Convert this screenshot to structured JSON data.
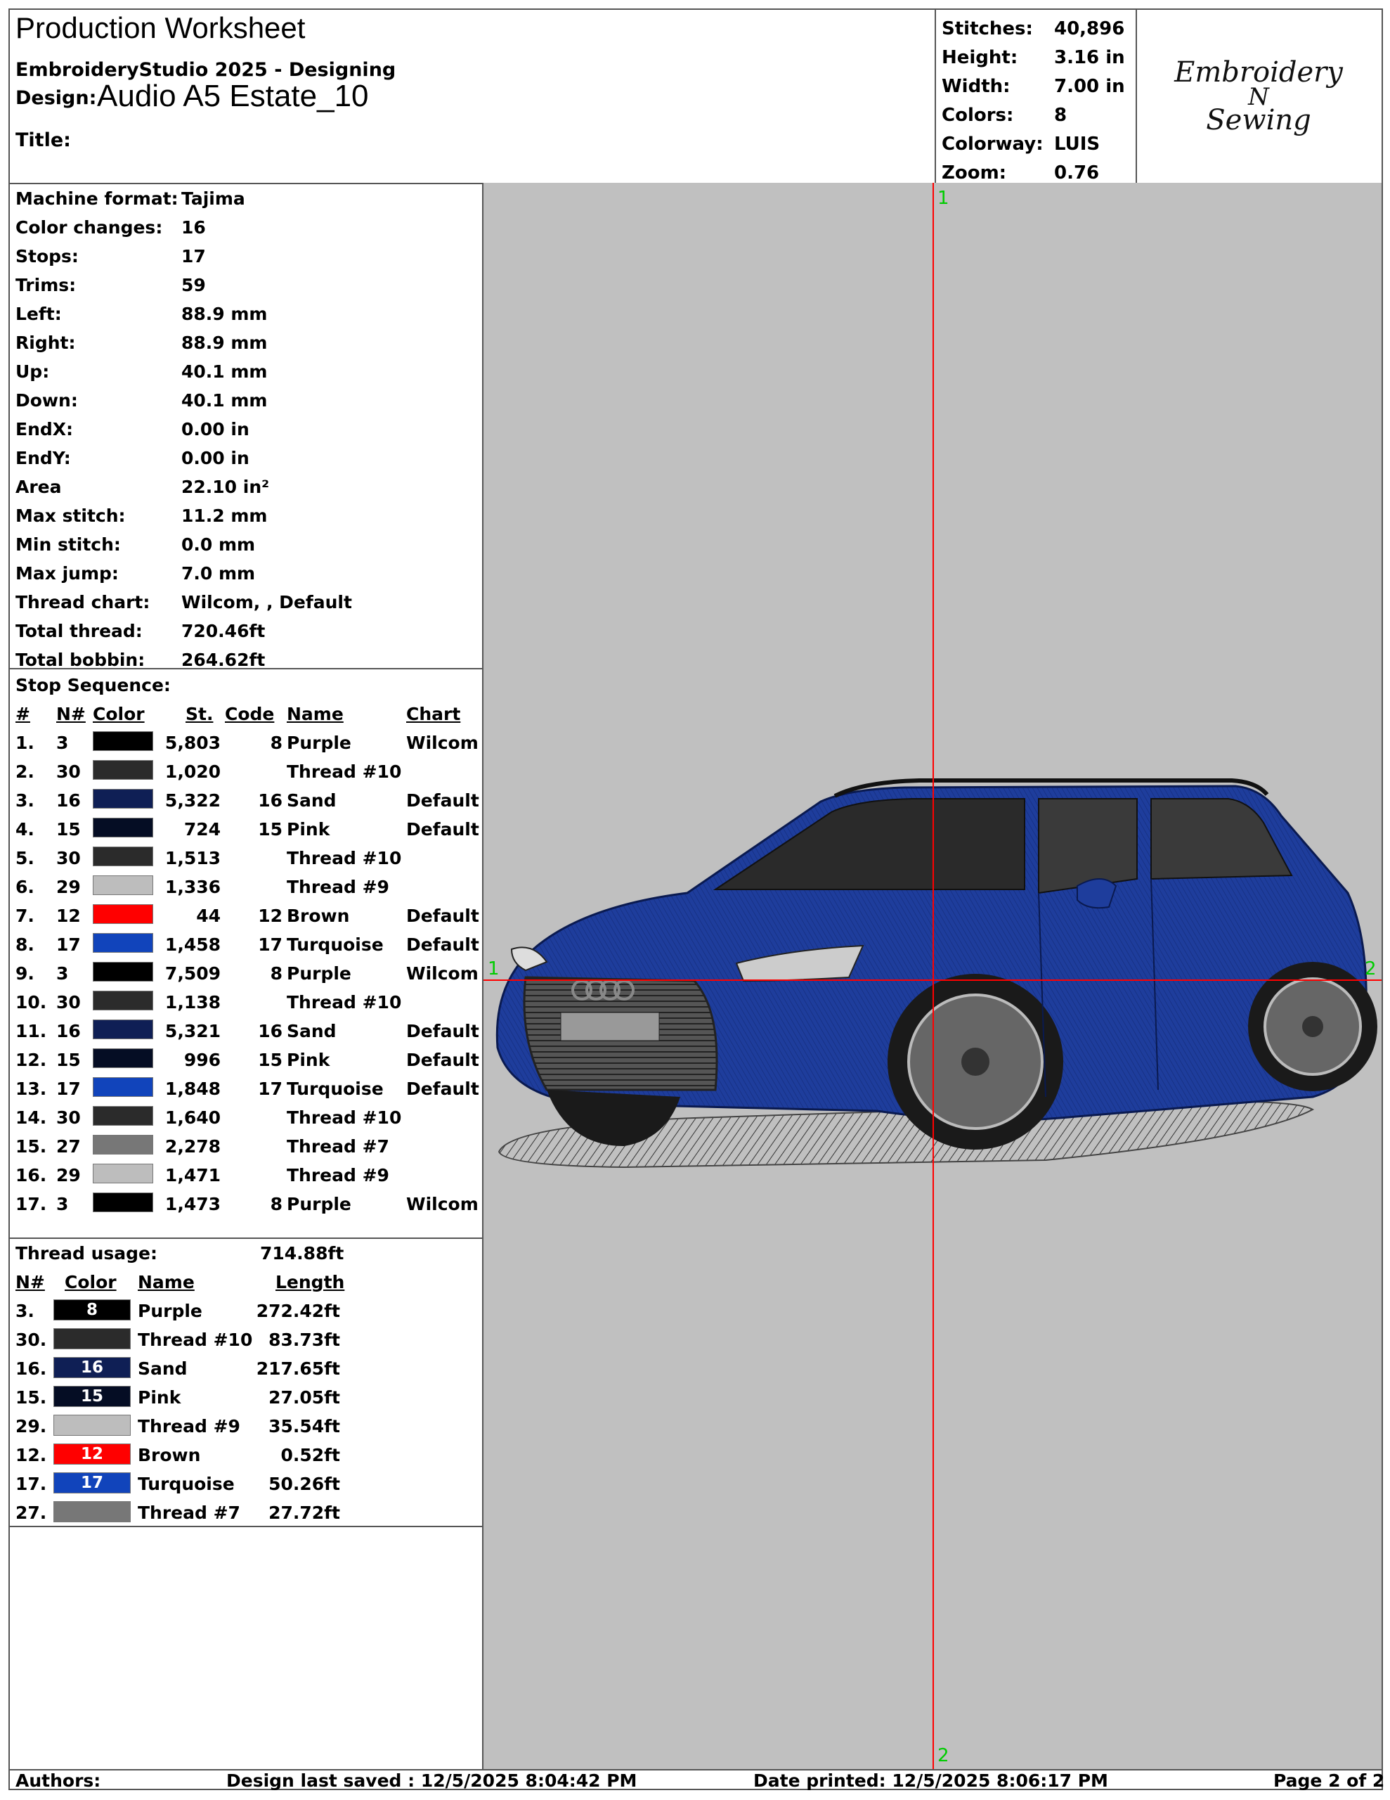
{
  "header": {
    "title": "Production Worksheet",
    "software": "EmbroideryStudio 2025 - Designing",
    "design_label": "Design:",
    "design_name": "Audio A5 Estate_10",
    "title_label": "Title:"
  },
  "stats": [
    {
      "label": "Stitches:",
      "value": "40,896"
    },
    {
      "label": "Height:",
      "value": "3.16 in"
    },
    {
      "label": "Width:",
      "value": "7.00 in"
    },
    {
      "label": "Colors:",
      "value": "8"
    },
    {
      "label": "Colorway:",
      "value": "LUIS"
    },
    {
      "label": "Zoom:",
      "value": "0.76"
    }
  ],
  "logo": {
    "line1": "Embroidery",
    "line2": "N",
    "line3": "Sewing"
  },
  "machine_info": [
    {
      "label": "Machine format:",
      "value": "Tajima"
    },
    {
      "label": "Color changes:",
      "value": "16"
    },
    {
      "label": "Stops:",
      "value": "17"
    },
    {
      "label": "Trims:",
      "value": "59"
    },
    {
      "label": "Left:",
      "value": "88.9 mm"
    },
    {
      "label": "Right:",
      "value": "88.9 mm"
    },
    {
      "label": "Up:",
      "value": "40.1 mm"
    },
    {
      "label": "Down:",
      "value": "40.1 mm"
    },
    {
      "label": "EndX:",
      "value": "0.00 in"
    },
    {
      "label": "EndY:",
      "value": "0.00 in"
    },
    {
      "label": "Area",
      "value": " 22.10 in²"
    },
    {
      "label": "Max stitch:",
      "value": "11.2 mm"
    },
    {
      "label": "Min stitch:",
      "value": "0.0 mm"
    },
    {
      "label": "Max jump:",
      "value": "7.0 mm"
    },
    {
      "label": "Thread chart:",
      "value": "Wilcom, , Default"
    },
    {
      "label": "Total thread:",
      "value": "720.46ft"
    },
    {
      "label": "Total bobbin:",
      "value": "264.62ft"
    }
  ],
  "stop_sequence": {
    "title": "Stop Sequence:",
    "headers": {
      "num": "#",
      "n": "N#",
      "color": "Color",
      "st": "St.",
      "code": "Code",
      "name": "Name",
      "chart": "Chart"
    },
    "rows": [
      {
        "num": "1.",
        "n": "3",
        "color": "#000000",
        "st": "5,803",
        "code": "8",
        "name": "Purple",
        "chart": "Wilcom"
      },
      {
        "num": "2.",
        "n": "30",
        "color": "#2b2b2b",
        "st": "1,020",
        "code": "",
        "name": "Thread #10",
        "chart": ""
      },
      {
        "num": "3.",
        "n": "16",
        "color": "#0f1f55",
        "st": "5,322",
        "code": "16",
        "name": "Sand",
        "chart": "Default"
      },
      {
        "num": "4.",
        "n": "15",
        "color": "#050d24",
        "st": "724",
        "code": "15",
        "name": "Pink",
        "chart": "Default"
      },
      {
        "num": "5.",
        "n": "30",
        "color": "#2b2b2b",
        "st": "1,513",
        "code": "",
        "name": "Thread #10",
        "chart": ""
      },
      {
        "num": "6.",
        "n": "29",
        "color": "#bdbdbd",
        "st": "1,336",
        "code": "",
        "name": "Thread #9",
        "chart": ""
      },
      {
        "num": "7.",
        "n": "12",
        "color": "#ff0000",
        "st": "44",
        "code": "12",
        "name": "Brown",
        "chart": "Default"
      },
      {
        "num": "8.",
        "n": "17",
        "color": "#1144bb",
        "st": "1,458",
        "code": "17",
        "name": "Turquoise",
        "chart": "Default"
      },
      {
        "num": "9.",
        "n": "3",
        "color": "#000000",
        "st": "7,509",
        "code": "8",
        "name": "Purple",
        "chart": "Wilcom"
      },
      {
        "num": "10.",
        "n": "30",
        "color": "#2b2b2b",
        "st": "1,138",
        "code": "",
        "name": "Thread #10",
        "chart": ""
      },
      {
        "num": "11.",
        "n": "16",
        "color": "#0f1f55",
        "st": "5,321",
        "code": "16",
        "name": "Sand",
        "chart": "Default"
      },
      {
        "num": "12.",
        "n": "15",
        "color": "#050d24",
        "st": "996",
        "code": "15",
        "name": "Pink",
        "chart": "Default"
      },
      {
        "num": "13.",
        "n": "17",
        "color": "#1144bb",
        "st": "1,848",
        "code": "17",
        "name": "Turquoise",
        "chart": "Default"
      },
      {
        "num": "14.",
        "n": "30",
        "color": "#2b2b2b",
        "st": "1,640",
        "code": "",
        "name": "Thread #10",
        "chart": ""
      },
      {
        "num": "15.",
        "n": "27",
        "color": "#777777",
        "st": "2,278",
        "code": "",
        "name": "Thread #7",
        "chart": ""
      },
      {
        "num": "16.",
        "n": "29",
        "color": "#bdbdbd",
        "st": "1,471",
        "code": "",
        "name": "Thread #9",
        "chart": ""
      },
      {
        "num": "17.",
        "n": "3",
        "color": "#000000",
        "st": "1,473",
        "code": "8",
        "name": "Purple",
        "chart": "Wilcom"
      }
    ]
  },
  "thread_usage": {
    "title": "Thread usage:",
    "total": "714.88ft",
    "headers": {
      "n": "N#",
      "color": "Color",
      "name": "Name",
      "length": "Length"
    },
    "rows": [
      {
        "n": "3.",
        "color": "#000000",
        "code": "8",
        "name": "Purple",
        "length": "272.42ft"
      },
      {
        "n": "30.",
        "color": "#2b2b2b",
        "code": "",
        "name": "Thread #10",
        "length": "83.73ft"
      },
      {
        "n": "16.",
        "color": "#0f1f55",
        "code": "16",
        "name": "Sand",
        "length": "217.65ft"
      },
      {
        "n": "15.",
        "color": "#050d24",
        "code": "15",
        "name": "Pink",
        "length": "27.05ft"
      },
      {
        "n": "29.",
        "color": "#bdbdbd",
        "code": "",
        "name": "Thread #9",
        "length": "35.54ft"
      },
      {
        "n": "12.",
        "color": "#ff0000",
        "code": "12",
        "name": "Brown",
        "length": "0.52ft"
      },
      {
        "n": "17.",
        "color": "#1144bb",
        "code": "17",
        "name": "Turquoise",
        "length": "50.26ft"
      },
      {
        "n": "27.",
        "color": "#777777",
        "code": "",
        "name": "Thread #7",
        "length": "27.72ft"
      }
    ]
  },
  "canvas": {
    "background": "#c0c0c0",
    "axis_color": "#ff0000",
    "marker_color": "#00cc00",
    "car_color": "#1e3d9c",
    "markers": {
      "top": "1",
      "bottom": "2",
      "left": "1",
      "right": "2"
    }
  },
  "footer": {
    "authors": "Authors:",
    "saved": "Design last saved : 12/5/2025 8:04:42 PM",
    "printed": "Date printed: 12/5/2025 8:06:17 PM",
    "page": "Page 2 of 2"
  }
}
